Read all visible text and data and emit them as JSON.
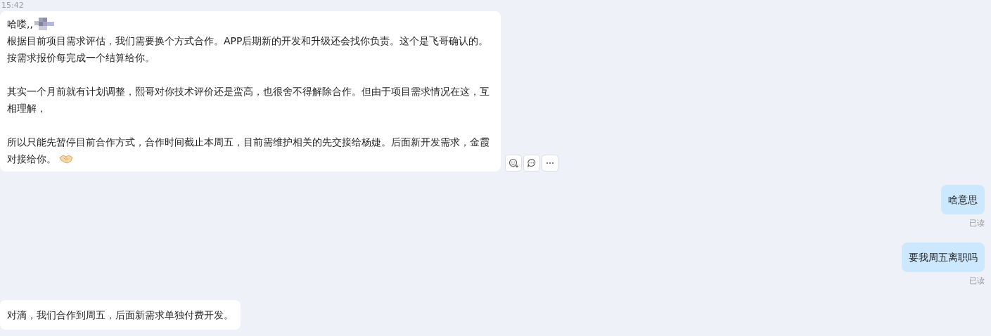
{
  "timestamp": "15:42",
  "messages": [
    {
      "outgoing": false,
      "kind": "announcement",
      "hovered": true,
      "paragraphs": [
        "哈喽,,",
        "根据目前项目需求评估，我们需要换个方式合作。APP后期新的开发和升级还会找你负责。这个是飞哥确认的。按需求报价每完成一个结算给你。",
        "其实一个月前就有计划调整，熙哥对你技术评价还是蛮高，也很舍不得解除合作。但由于项目需求情况在这，互相理解，",
        "所以只能先暂停目前合作方式，合作时间截止本周五，目前需维护相关的先交接给杨婕。后面新开发需求，金霞对接给你。"
      ]
    },
    {
      "outgoing": true,
      "kind": "text",
      "hovered": false,
      "paragraphs": [
        "啥意思"
      ],
      "status": "已读"
    },
    {
      "outgoing": true,
      "kind": "text",
      "hovered": false,
      "paragraphs": [
        "要我周五离职吗"
      ],
      "status": "已读"
    },
    {
      "outgoing": false,
      "kind": "text",
      "hovered": false,
      "paragraphs": [
        "对滴，我们合作到周五，后面新需求单独付费开发。"
      ]
    }
  ]
}
